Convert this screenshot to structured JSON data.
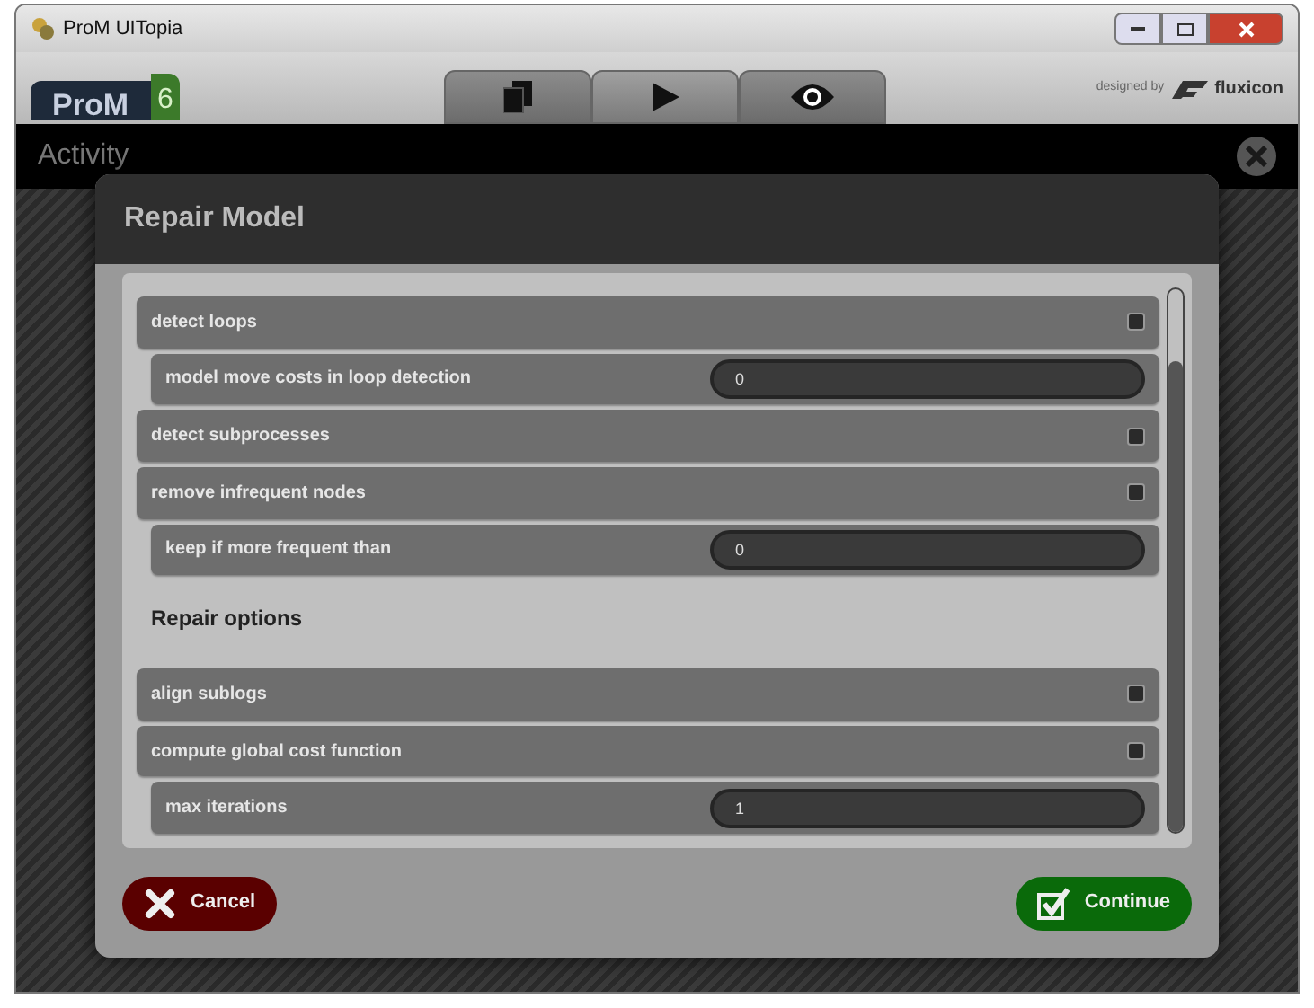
{
  "window": {
    "title": "ProM UITopia"
  },
  "header": {
    "logo": {
      "name": "ProM",
      "version": "6"
    },
    "tabs": [
      {
        "kind": "documents",
        "selected": false
      },
      {
        "kind": "play",
        "selected": true
      },
      {
        "kind": "eye",
        "selected": false
      }
    ],
    "credit": {
      "prefix": "designed by",
      "brand": "fluxicon"
    }
  },
  "activity": {
    "title": "Activity"
  },
  "dialog": {
    "title": "Repair Model",
    "items": [
      {
        "kind": "checkbox",
        "label": "detect loops",
        "checked": false,
        "children": [
          {
            "kind": "number",
            "label": "model move costs in loop detection",
            "value": "0"
          }
        ]
      },
      {
        "kind": "checkbox",
        "label": "detect subprocesses",
        "checked": false
      },
      {
        "kind": "checkbox",
        "label": "remove infrequent nodes",
        "checked": false,
        "children": [
          {
            "kind": "number",
            "label": "keep if more frequent than",
            "value": "0"
          }
        ]
      },
      {
        "kind": "heading",
        "label": "Repair options"
      },
      {
        "kind": "checkbox",
        "label": "align sublogs",
        "checked": false
      },
      {
        "kind": "checkbox",
        "label": "compute global cost function",
        "checked": false,
        "children": [
          {
            "kind": "number",
            "label": "max iterations",
            "value": "1"
          }
        ]
      }
    ],
    "buttons": [
      {
        "kind": "cancel",
        "label": "Cancel"
      },
      {
        "kind": "continue",
        "label": "Continue"
      }
    ]
  }
}
